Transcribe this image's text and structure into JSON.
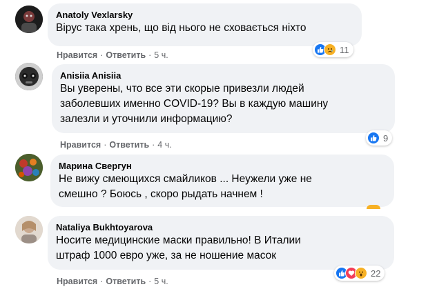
{
  "comments": [
    {
      "author": "Anatoly Vexlarsky",
      "text": "Вірус така хрень, що від нього не сховається ніхто",
      "like_label": "Нравится",
      "reply_label": "Ответить",
      "time": "5 ч.",
      "reaction_count": "11",
      "reactions": [
        "like-icon",
        "sad-icon"
      ]
    },
    {
      "author": "Anisiia Anisiia",
      "text": "Вы уверены, что все эти скорые привезли людей\nзаболевших именно COVID-19? Вы в каждую машину\nзалезли и уточнили информацию?",
      "like_label": "Нравится",
      "reply_label": "Ответить",
      "time": "4 ч.",
      "reaction_count": "9",
      "reactions": [
        "like-icon"
      ]
    },
    {
      "author": "Марина Свергун",
      "text": "Не вижу смеющихся смайликов ... Неужели уже не\nсмешно ? Боюсь , скоро рыдать начнем !",
      "reactions": [
        "haha-icon"
      ]
    },
    {
      "author": "Nataliya Bukhtoyarova",
      "text": "Носите медицинские маски правильно! В Италии\nштраф 1000 евро уже, за не ношение масок",
      "like_label": "Нравится",
      "reply_label": "Ответить",
      "time": "5 ч.",
      "reaction_count": "22",
      "reactions": [
        "like-icon",
        "love-icon",
        "wow-icon"
      ]
    }
  ],
  "colors": {
    "bubble_bg": "#f0f2f5",
    "meta_text": "#65676b",
    "like_blue": "#1877f2",
    "love_red": "#f33e58",
    "emoji_yellow": "#f7b125"
  }
}
